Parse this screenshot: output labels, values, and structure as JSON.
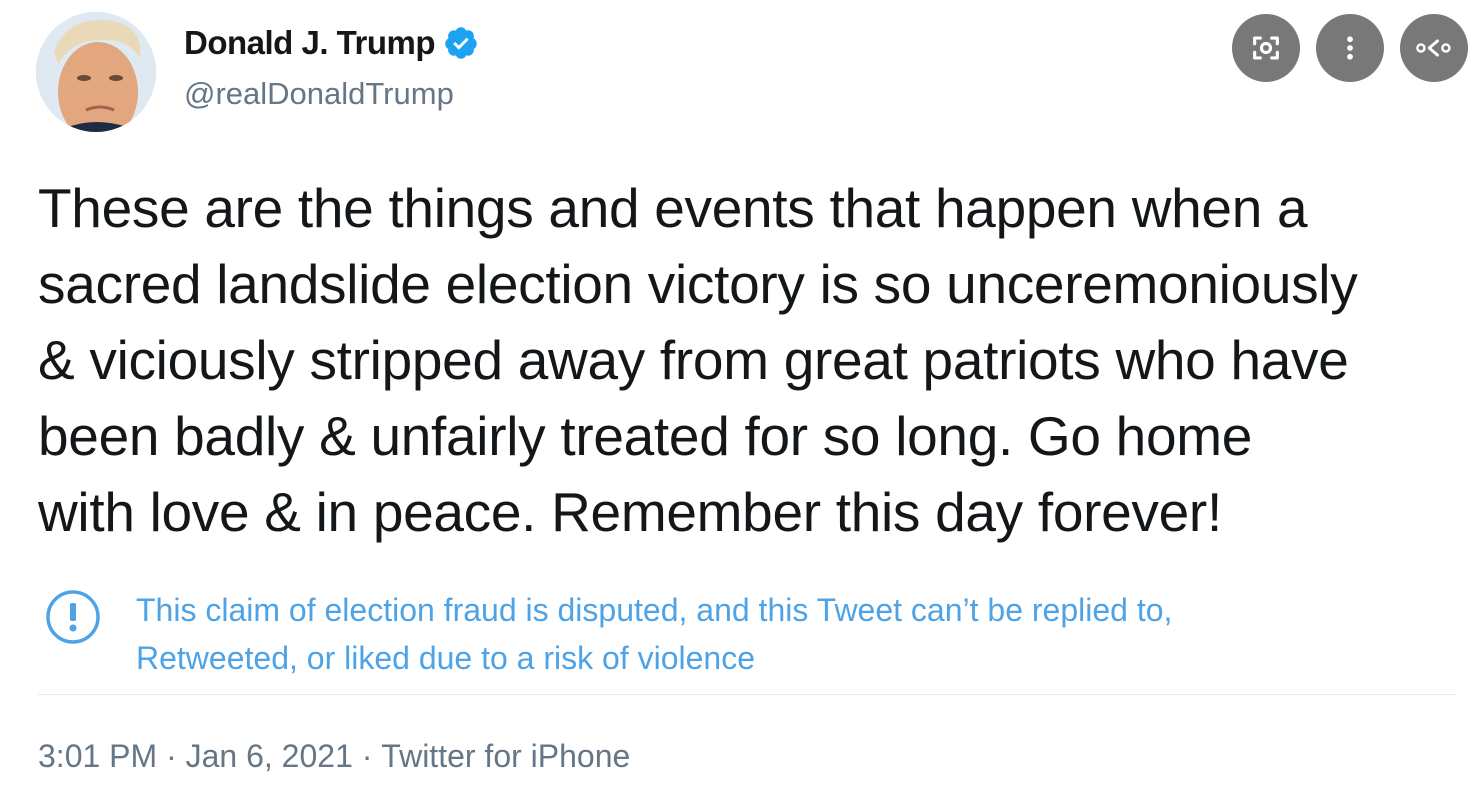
{
  "user": {
    "display_name": "Donald J. Trump",
    "handle": "@realDonaldTrump",
    "verified": true,
    "avatar_icon": "profile-photo"
  },
  "tweet": {
    "text": "These are the things and events that happen when a\nsacred landslide election victory is so unceremoniously\n& viciously stripped away from great patriots who have\nbeen badly & unfairly treated for so long. Go home\nwith love & in peace. Remember this day forever!"
  },
  "notice": {
    "icon": "exclamation-circle-icon",
    "text": "This claim of election fraud is disputed, and this Tweet can’t be replied to,\nRetweeted, or liked due to a risk of violence"
  },
  "meta": {
    "time": "3:01 PM",
    "sep1": " · ",
    "date": "Jan 6, 2021",
    "sep2": " · ",
    "source": "Twitter for iPhone"
  },
  "overlay": {
    "buttons": [
      "lens-icon",
      "more-vertical-icon",
      "share-icon"
    ]
  },
  "colors": {
    "accent": "#1da1f2",
    "notice": "#4da3e5",
    "secondary_text": "#657786",
    "overlay_button": "#6a6a6a"
  }
}
